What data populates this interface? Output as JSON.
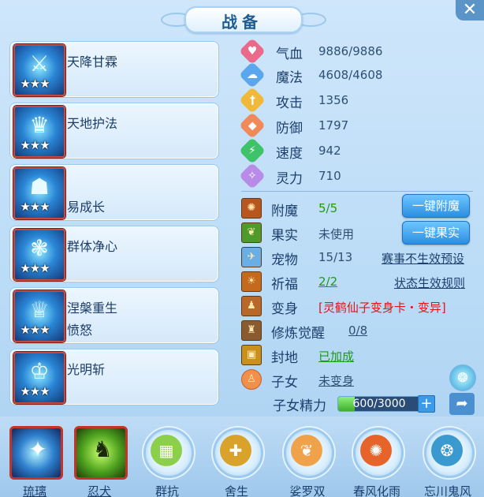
{
  "header": {
    "title": "战备",
    "close_label": "✕"
  },
  "skills": [
    {
      "name": "天降甘霖",
      "stars": "★★★",
      "icon": "trident-icon"
    },
    {
      "name": "天地护法",
      "stars": "★★★",
      "icon": "guardian-icon"
    },
    {
      "name": "易成长",
      "stars": "★★★",
      "icon": "growth-icon"
    },
    {
      "name": "群体净心",
      "stars": "★★★",
      "icon": "purify-icon"
    },
    {
      "name": "涅槃重生",
      "sub": "愤怒",
      "stars": "★★★",
      "icon": "rebirth-icon"
    },
    {
      "name": "光明斩",
      "stars": "★★★",
      "icon": "light-slash-icon"
    }
  ],
  "stats": [
    {
      "label": "气血",
      "value": "9886/9886",
      "icon": "heart-icon",
      "color": "#e96a8b"
    },
    {
      "label": "魔法",
      "value": "4608/4608",
      "icon": "mana-icon",
      "color": "#5aa7ee"
    },
    {
      "label": "攻击",
      "value": "1356",
      "icon": "sword-icon",
      "color": "#f0b93a"
    },
    {
      "label": "防御",
      "value": "1797",
      "icon": "shield-icon",
      "color": "#f08a5a"
    },
    {
      "label": "速度",
      "value": "942",
      "icon": "speed-icon",
      "color": "#3ec26a"
    },
    {
      "label": "灵力",
      "value": "710",
      "icon": "spirit-icon",
      "color": "#b88be8"
    }
  ],
  "extras": {
    "enchant": {
      "label": "附魔",
      "value": "5/5"
    },
    "fruit": {
      "label": "果实",
      "value": "未使用"
    },
    "pet": {
      "label": "宠物",
      "value": "15/13"
    },
    "blessing": {
      "label": "祈福",
      "value": "2/2"
    },
    "transform": {
      "label": "变身",
      "value": "[灵鹤仙子变身卡・变异]"
    },
    "awaken": {
      "label": "修炼觉醒",
      "value": "0/8"
    },
    "seal": {
      "label": "封地",
      "value": "已加成"
    },
    "child": {
      "label": "子女",
      "value": "未变身"
    },
    "child_energy": {
      "label": "子女精力",
      "value": "600/3000",
      "fraction": 0.2
    }
  },
  "buttons": {
    "enchant": "一键附魔",
    "fruit": "一键果实",
    "plus": "+"
  },
  "links": {
    "event_preset": "赛事不生效预设",
    "status_rules": "状态生效规则"
  },
  "bottom_slots": [
    {
      "label": "琉璃",
      "icon": "glaze-orb-icon",
      "glyph": "✦"
    },
    {
      "label": "忍犬",
      "icon": "ninja-dog-icon",
      "glyph": "🐺"
    },
    {
      "label": "群抗",
      "icon": "group-resist-icon",
      "glyph": "▦"
    },
    {
      "label": "舍生",
      "icon": "sacrifice-icon",
      "glyph": "✚"
    },
    {
      "label": "娑罗双",
      "icon": "sal-tree-icon",
      "glyph": "❦"
    },
    {
      "label": "春风化雨",
      "icon": "spring-rain-icon",
      "glyph": "✺"
    },
    {
      "label": "忘川鬼风",
      "icon": "ghost-wind-icon",
      "glyph": "❂"
    }
  ],
  "colors": {
    "accent": "#2b8ee0",
    "green_text": "#1c9a18",
    "red_text": "#e0141b",
    "card_border": "#9cc6ea"
  }
}
